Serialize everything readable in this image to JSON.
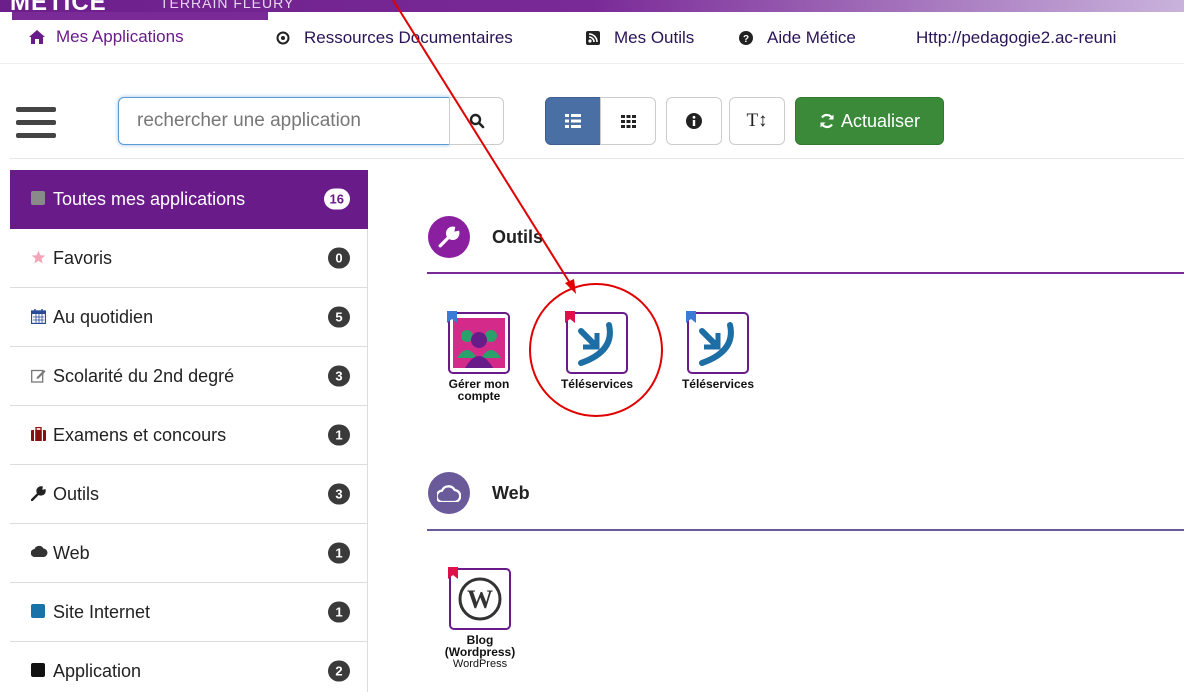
{
  "brand": "MÉTICE",
  "school": "TERRAIN FLEURY",
  "nav": {
    "tabs": [
      {
        "label": "Mes Applications",
        "icon": "home-icon"
      },
      {
        "label": "Ressources Documentaires",
        "icon": "circle-dot-icon"
      },
      {
        "label": "Mes Outils",
        "icon": "rss-icon"
      },
      {
        "label": "Aide Métice",
        "icon": "question-icon"
      },
      {
        "label": "Http://pedagogie2.ac-reuni",
        "icon": ""
      }
    ]
  },
  "toolbar": {
    "search_placeholder": "rechercher une application",
    "refresh_label": "Actualiser",
    "text_size_label": "T↕"
  },
  "sidebar": {
    "items": [
      {
        "label": "Toutes mes applications",
        "count": "16",
        "icon": "square-icon",
        "color": "#888888"
      },
      {
        "label": "Favoris",
        "count": "0",
        "icon": "star-icon",
        "color": "#f4a6b8"
      },
      {
        "label": "Au quotidien",
        "count": "5",
        "icon": "calendar-icon",
        "color": "#2a4a9a"
      },
      {
        "label": "Scolarité du 2nd degré",
        "count": "3",
        "icon": "edit-icon",
        "color": "#888888"
      },
      {
        "label": "Examens et concours",
        "count": "1",
        "icon": "briefcase-icon",
        "color": "#8a1010"
      },
      {
        "label": "Outils",
        "count": "3",
        "icon": "wrench-icon",
        "color": "#222222"
      },
      {
        "label": "Web",
        "count": "1",
        "icon": "cloud-icon",
        "color": "#333333"
      },
      {
        "label": "Site Internet",
        "count": "1",
        "icon": "square-icon",
        "color": "#1a73a8"
      },
      {
        "label": "Application",
        "count": "2",
        "icon": "square-icon",
        "color": "#111111"
      }
    ]
  },
  "sections": [
    {
      "title": "Outils",
      "color": "#8a1fa0",
      "line_color": "#7a2a97",
      "apps": [
        {
          "name": "Gérer mon",
          "name2": "compte",
          "flag": "#3a7bd5"
        },
        {
          "name": "Téléservices",
          "flag": "#e0104a"
        },
        {
          "name": "Téléservices",
          "flag": "#3a7bd5"
        }
      ]
    },
    {
      "title": "Web",
      "color": "#6a5a9a",
      "line_color": "#6a5a9a",
      "apps": [
        {
          "name": "Blog",
          "name2": "(Wordpress)",
          "sub": "WordPress",
          "flag": "#e0104a"
        }
      ]
    }
  ],
  "annotation_color": "#e00000"
}
